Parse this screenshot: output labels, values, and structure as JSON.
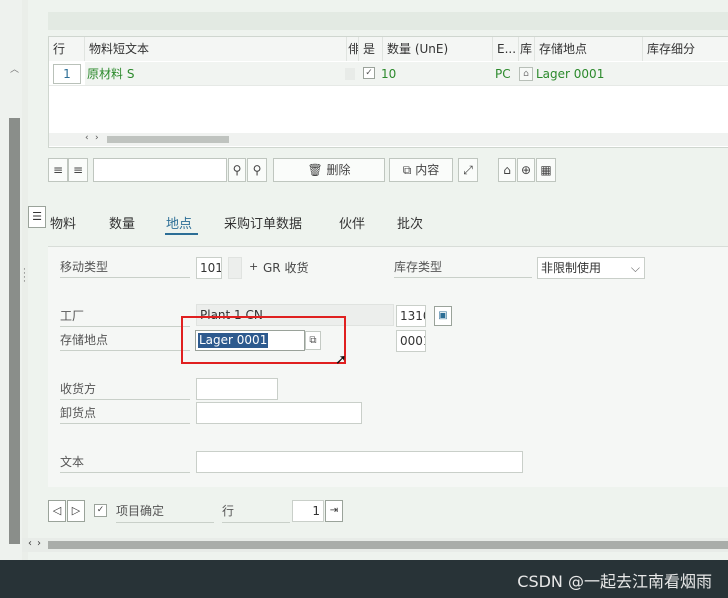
{
  "table": {
    "headers": {
      "row": "行",
      "short_text": "物料短文本",
      "flag": "俳",
      "ok": "是",
      "qty": "数量 (UnE)",
      "unit": "E...",
      "stock_loc_abbr": "库",
      "stock_loc": "存储地点",
      "stock_segment": "库存细分"
    },
    "row": {
      "row_no": "1",
      "short_text": "原材料 S",
      "qty": "10",
      "unit": "PC",
      "stock_loc": "Lager 0001"
    }
  },
  "toolbar": {
    "delete_label": "删除",
    "content_label": "内容"
  },
  "tabs": [
    "物料",
    "数量",
    "地点",
    "采购订单数据",
    "伙伴",
    "批次"
  ],
  "form": {
    "movement_type_label": "移动类型",
    "movement_type_value": "101",
    "movement_type_sign": "+",
    "movement_type_text": "GR 收货",
    "stock_type_label": "库存类型",
    "stock_type_value": "非限制使用",
    "plant_label": "工厂",
    "plant_value": "Plant 1 CN",
    "plant_code": "1310",
    "storage_location_label": "存储地点",
    "storage_location_value": "Lager 0001",
    "storage_location_code": "0001",
    "goods_recipient_label": "收货方",
    "unloading_point_label": "卸货点",
    "text_label": "文本"
  },
  "bottom": {
    "item_ok_label": "项目确定",
    "row_label": "行",
    "row_value": "1"
  },
  "watermark": "CSDN @一起去江南看烟雨",
  "colors": {
    "accent": "#2c6e96",
    "value_green": "#2c8a2c",
    "highlight_red": "#e02020",
    "selection_blue": "#2d5a8e"
  }
}
